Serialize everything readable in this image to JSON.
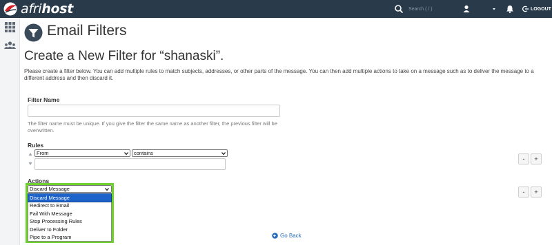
{
  "topbar": {
    "logo_prefix": "afri",
    "logo_suffix": "host",
    "search_placeholder": "Search ( / )",
    "logout_label": "LOGOUT",
    "icons": [
      "search-icon",
      "user-icon",
      "chevron-down-icon",
      "bell-icon",
      "logout-icon"
    ]
  },
  "sidebar": {
    "icons": [
      "grid-icon",
      "users-icon"
    ]
  },
  "page": {
    "title": "Email Filters",
    "subtitle": "Create a New Filter for “shanaski”.",
    "intro": "Please create a filter below. You can add multiple rules to match subjects, addresses, or other parts of the message. You can then add multiple actions to take on a message such as to deliver the message to a different address and then discard it."
  },
  "filter_name": {
    "label": "Filter Name",
    "value": "",
    "help": "The filter name must be unique. If you give the filter the same name as another filter, the previous filter will be overwritten."
  },
  "rules": {
    "label": "Rules",
    "field_selected": "From",
    "operator_selected": "contains",
    "value": "",
    "remove_label": "-",
    "add_label": "+"
  },
  "actions": {
    "label": "Actions",
    "selected": "Discard Message",
    "options": [
      "Discard Message",
      "Redirect to Email",
      "Fail With Message",
      "Stop Processing Rules",
      "Deliver to Folder",
      "Pipe to a Program"
    ],
    "remove_label": "-",
    "add_label": "+"
  },
  "go_back_label": "Go Back",
  "colors": {
    "topbar": "#293a4a",
    "highlight": "#6fd12b",
    "selected_option": "#1e63c9",
    "link": "#2a6ebb"
  }
}
